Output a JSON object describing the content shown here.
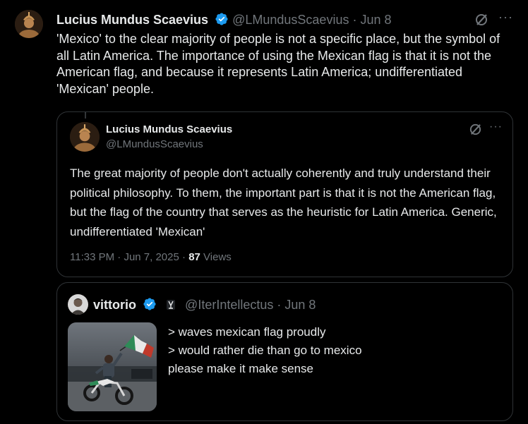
{
  "main_tweet": {
    "author_name": "Lucius Mundus Scaevius",
    "handle": "@LMundusScaevius",
    "separator": "·",
    "date": "Jun 8",
    "text": "'Mexico' to the clear majority of people is not a specific place, but the symbol of all Latin America. The importance of using the Mexican flag is that it is not the American flag, and because it represents Latin America; undifferentiated 'Mexican' people.",
    "more_label": "···"
  },
  "quoted_tweet": {
    "author_name": "Lucius Mundus Scaevius",
    "handle": "@LMundusScaevius",
    "text": "The great majority of people don't actually coherently and truly understand their political philosophy. To them, the important part is that it is not the American flag, but the flag of the country that serves as the heuristic for Latin America. Generic, undifferentiated 'Mexican'",
    "time": "11:33 PM",
    "separator": "·",
    "date": "Jun 7, 2025",
    "views_count": "87",
    "views_label": "Views",
    "more_label": "···"
  },
  "second_quote": {
    "author_name": "vittorio",
    "handle": "@IterIntellectus",
    "separator": "·",
    "date": "Jun 8",
    "text_lines": [
      "> waves mexican flag proudly",
      "> would rather die than go to mexico",
      "please make it make sense"
    ]
  },
  "colors": {
    "background": "#000000",
    "text": "#e7e9ea",
    "muted": "#71767b",
    "border": "#2f3336",
    "verified": "#1d9bf0"
  }
}
